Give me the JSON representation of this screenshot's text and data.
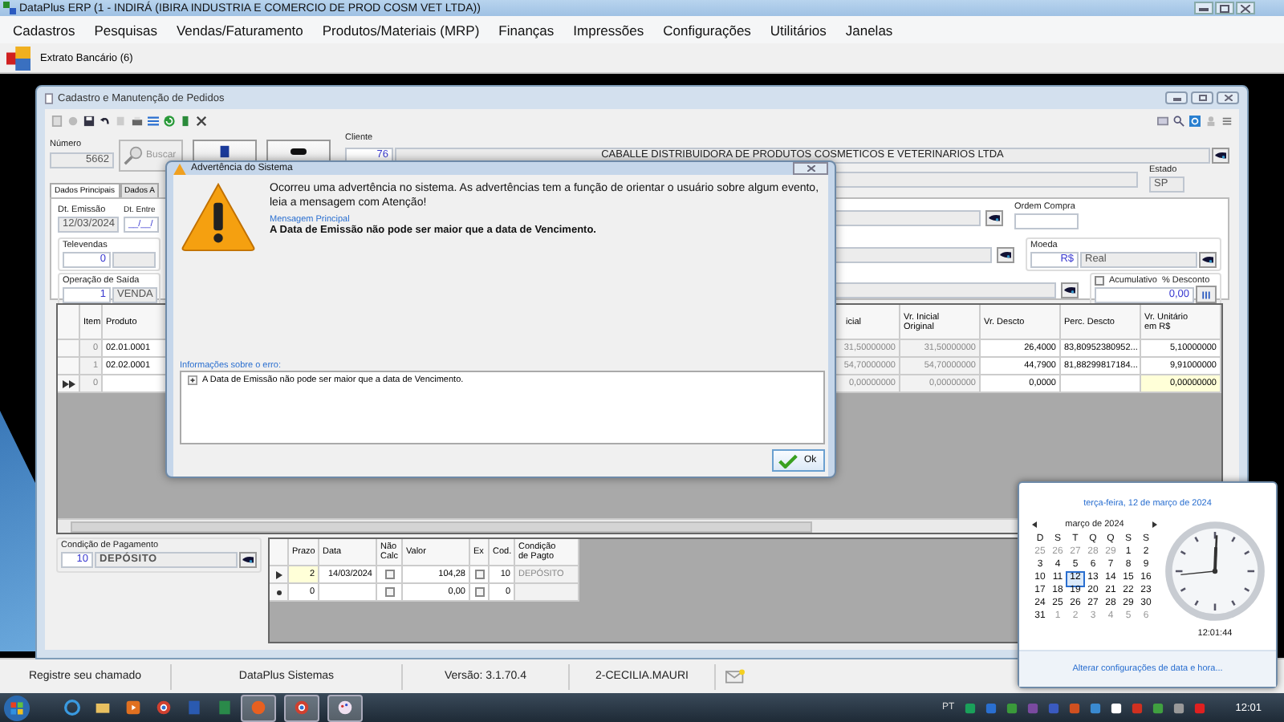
{
  "app": {
    "title": "DataPlus ERP (1 - INDIRÁ  (IBIRA INDUSTRIA E COMERCIO DE PROD COSM VET LTDA))"
  },
  "menu": [
    "Cadastros",
    "Pesquisas",
    "Vendas/Faturamento",
    "Produtos/Materiais (MRP)",
    "Finanças",
    "Impressões",
    "Configurações",
    "Utilitários",
    "Janelas"
  ],
  "toolbar": {
    "shortcut": "Extrato Bancário (6)"
  },
  "order_window": {
    "title": "Cadastro e Manutenção de Pedidos",
    "numero": {
      "label": "Número",
      "value": "5662"
    },
    "search_button": "Buscar",
    "cliente": {
      "label": "Cliente",
      "code": "76",
      "name": "CABALLE DISTRIBUIDORA DE PRODUTOS COSMETICOS E VETERINARIOS LTDA"
    },
    "estado": {
      "label": "Estado",
      "value": "SP"
    },
    "tabs": [
      {
        "label": "Dados Principais",
        "selected": true
      },
      {
        "label": "Dados A",
        "selected": false
      }
    ],
    "dt_emissao": {
      "label": "Dt. Emissão",
      "value": "12/03/2024"
    },
    "dt_entrega": {
      "label": "Dt. Entre",
      "value": "__/__/"
    },
    "ordem_compra": {
      "label": "Ordem Compra"
    },
    "televendas": {
      "label": "Televendas",
      "value": "0"
    },
    "moeda": {
      "label": "Moeda",
      "code": "R$",
      "name": "Real"
    },
    "operacao": {
      "label": "Operação de Saída",
      "code": "1",
      "name": "VENDA"
    },
    "acumulativo": {
      "label": "Acumulativo",
      "checked": false
    },
    "desconto": {
      "label": "% Desconto",
      "value": "0,00"
    },
    "items_grid": {
      "left_columns": [
        {
          "label": "Item",
          "readonly": true
        },
        {
          "label": "Produto",
          "readonly": false
        }
      ],
      "right_columns": [
        {
          "label": "icial",
          "readonly": true
        },
        {
          "label": "Vr. Inicial\nOriginal",
          "readonly": true
        },
        {
          "label": "Vr. Descto",
          "readonly": false
        },
        {
          "label": "Perc. Descto",
          "readonly": false
        },
        {
          "label": "Vr. Unitário\nem R$",
          "readonly": false
        }
      ],
      "rows": [
        {
          "current": false,
          "new": false,
          "left": [
            {
              "text": "0",
              "focused": false
            },
            {
              "text": "02.01.0001",
              "focused": false
            }
          ],
          "right": [
            {
              "text": "31,50000000",
              "focused": false
            },
            {
              "text": "31,50000000",
              "focused": false
            },
            {
              "text": "26,4000",
              "focused": false
            },
            {
              "text": "83,80952380952...",
              "focused": false
            },
            {
              "text": "5,10000000",
              "focused": false
            }
          ]
        },
        {
          "current": false,
          "new": false,
          "left": [
            {
              "text": "1",
              "focused": false
            },
            {
              "text": "02.02.0001",
              "focused": false
            }
          ],
          "right": [
            {
              "text": "54,70000000",
              "focused": false
            },
            {
              "text": "54,70000000",
              "focused": false
            },
            {
              "text": "44,7900",
              "focused": false
            },
            {
              "text": "81,88299817184...",
              "focused": false
            },
            {
              "text": "9,91000000",
              "focused": false
            }
          ]
        },
        {
          "current": true,
          "new": true,
          "left": [
            {
              "text": "0",
              "focused": false
            },
            {
              "focused": false
            }
          ],
          "right": [
            {
              "text": "0,00000000",
              "focused": false
            },
            {
              "text": "0,00000000",
              "focused": false
            },
            {
              "text": "0,0000",
              "focused": false
            },
            {
              "focused": false
            },
            {
              "text": "0,00000000",
              "focused": true
            }
          ]
        }
      ]
    },
    "condicao": {
      "label": "Condição de Pagamento",
      "code": "10",
      "name": "DEPÓSITO"
    },
    "payment_grid": {
      "columns": [
        {
          "label": "Prazo",
          "kind": "text",
          "readonly": false
        },
        {
          "label": "Data",
          "kind": "text",
          "readonly": false
        },
        {
          "label": "Não\nCalc",
          "kind": "check",
          "readonly": false
        },
        {
          "label": "Valor",
          "kind": "text",
          "readonly": false
        },
        {
          "label": "Ex",
          "kind": "check",
          "readonly": false
        },
        {
          "label": "Cod.",
          "kind": "text",
          "readonly": false
        },
        {
          "label": "Condição\nde Pagto",
          "kind": "text",
          "readonly": true
        }
      ],
      "rows": [
        {
          "current": true,
          "new": false,
          "cells": [
            {
              "text": "2",
              "focused": true
            },
            {
              "text": "14/03/2024",
              "focused": false
            },
            {
              "checked": false
            },
            {
              "text": "104,28",
              "focused": false
            },
            {
              "checked": false
            },
            {
              "text": "10",
              "focused": false
            },
            {
              "text": "DEPÓSITO",
              "focused": false
            }
          ]
        },
        {
          "current": false,
          "new": true,
          "cells": [
            {
              "text": "0",
              "focused": false
            },
            {
              "focused": false
            },
            {
              "checked": false
            },
            {
              "text": "0,00",
              "focused": false
            },
            {
              "checked": false
            },
            {
              "text": "0",
              "focused": false
            },
            {
              "focused": false
            }
          ]
        }
      ]
    }
  },
  "dialog": {
    "title": "Advertência do Sistema",
    "message": "Ocorreu uma advertência no sistema. As advertências tem a função de orientar o usuário sobre algum evento, leia a mensagem com Atenção!",
    "main_label": "Mensagem Principal",
    "main_message": "A Data de Emissão não pode ser maior que a data de Vencimento.",
    "details_label": "Informações sobre o erro:",
    "details": [
      {
        "text": "A Data de Emissão não pode ser maior que a data de Vencimento.",
        "expanded": false
      }
    ],
    "ok": "Ok"
  },
  "status_bar": [
    "Registre seu chamado",
    "DataPlus Sistemas",
    "Versão: 3.1.70.4",
    "2-CECILIA.MAURI"
  ],
  "calendar": {
    "date_link": "terça-feira, 12 de março de 2024",
    "month": "março de 2024",
    "weekdays": [
      "D",
      "S",
      "T",
      "Q",
      "Q",
      "S",
      "S"
    ],
    "weeks": [
      [
        {
          "d": "25",
          "current": false,
          "selected": false
        },
        {
          "d": "26",
          "current": false,
          "selected": false
        },
        {
          "d": "27",
          "current": false,
          "selected": false
        },
        {
          "d": "28",
          "current": false,
          "selected": false
        },
        {
          "d": "29",
          "current": false,
          "selected": false
        },
        {
          "d": "1",
          "current": true,
          "selected": false
        },
        {
          "d": "2",
          "current": true,
          "selected": false
        }
      ],
      [
        {
          "d": "3",
          "current": true,
          "selected": false
        },
        {
          "d": "4",
          "current": true,
          "selected": false
        },
        {
          "d": "5",
          "current": true,
          "selected": false
        },
        {
          "d": "6",
          "current": true,
          "selected": false
        },
        {
          "d": "7",
          "current": true,
          "selected": false
        },
        {
          "d": "8",
          "current": true,
          "selected": false
        },
        {
          "d": "9",
          "current": true,
          "selected": false
        }
      ],
      [
        {
          "d": "10",
          "current": true,
          "selected": false
        },
        {
          "d": "11",
          "current": true,
          "selected": false
        },
        {
          "d": "12",
          "current": true,
          "selected": true
        },
        {
          "d": "13",
          "current": true,
          "selected": false
        },
        {
          "d": "14",
          "current": true,
          "selected": false
        },
        {
          "d": "15",
          "current": true,
          "selected": false
        },
        {
          "d": "16",
          "current": true,
          "selected": false
        }
      ],
      [
        {
          "d": "17",
          "current": true,
          "selected": false
        },
        {
          "d": "18",
          "current": true,
          "selected": false
        },
        {
          "d": "19",
          "current": true,
          "selected": false
        },
        {
          "d": "20",
          "current": true,
          "selected": false
        },
        {
          "d": "21",
          "current": true,
          "selected": false
        },
        {
          "d": "22",
          "current": true,
          "selected": false
        },
        {
          "d": "23",
          "current": true,
          "selected": false
        }
      ],
      [
        {
          "d": "24",
          "current": true,
          "selected": false
        },
        {
          "d": "25",
          "current": true,
          "selected": false
        },
        {
          "d": "26",
          "current": true,
          "selected": false
        },
        {
          "d": "27",
          "current": true,
          "selected": false
        },
        {
          "d": "28",
          "current": true,
          "selected": false
        },
        {
          "d": "29",
          "current": true,
          "selected": false
        },
        {
          "d": "30",
          "current": true,
          "selected": false
        }
      ],
      [
        {
          "d": "31",
          "current": true,
          "selected": false
        },
        {
          "d": "1",
          "current": false,
          "selected": false
        },
        {
          "d": "2",
          "current": false,
          "selected": false
        },
        {
          "d": "3",
          "current": false,
          "selected": false
        },
        {
          "d": "4",
          "current": false,
          "selected": false
        },
        {
          "d": "5",
          "current": false,
          "selected": false
        },
        {
          "d": "6",
          "current": false,
          "selected": false
        }
      ]
    ],
    "time": "12:01:44",
    "settings_link": "Alterar configurações de data e hora..."
  },
  "taskbar": {
    "language": "PT",
    "clock": "12:01"
  }
}
